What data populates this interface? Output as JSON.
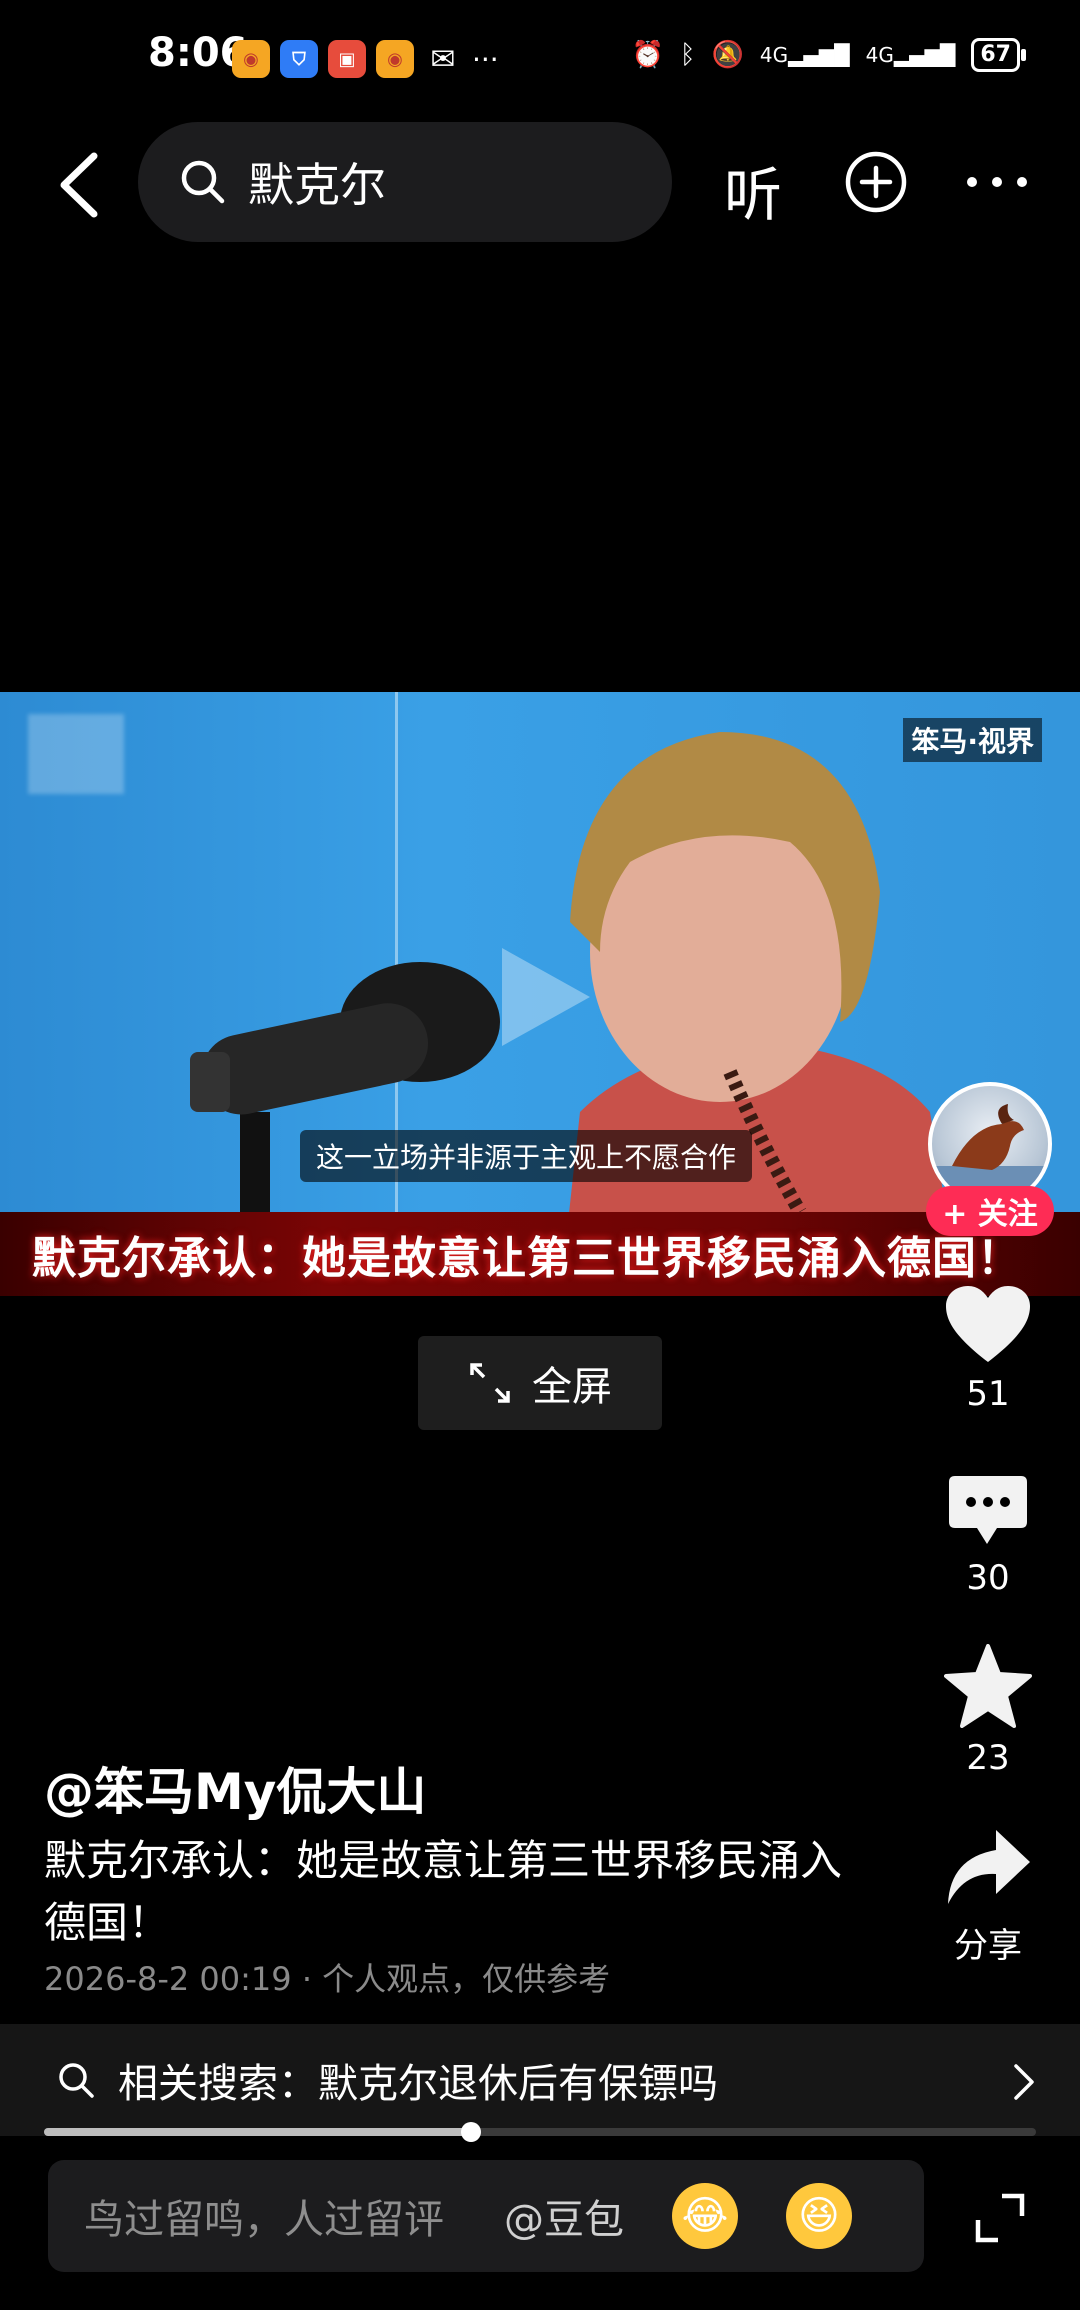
{
  "status_bar": {
    "time": "8:06",
    "apps": [
      {
        "icon": "weibo-icon",
        "color": "#f5a623"
      },
      {
        "icon": "shield-app-icon",
        "color": "#2f7cf6"
      },
      {
        "icon": "huawei-store-icon",
        "color": "#e74c3c"
      },
      {
        "icon": "weibo-icon",
        "color": "#f5a623"
      },
      {
        "icon": "wechat-icon",
        "color": "#ffffff"
      }
    ],
    "overflow": "···",
    "signal_left": "4G",
    "signal_right": "4G",
    "battery": "67"
  },
  "header": {
    "search_text": "默克尔",
    "listen_label": "听"
  },
  "video": {
    "watermark": "笨马·视界",
    "subtitle": "这一立场并非源于主观上不愿合作",
    "banner_title": "默克尔承认：她是故意让第三世界移民涌入德国！"
  },
  "follow_label": "+ 关注",
  "fullscreen_label": "全屏",
  "rail": {
    "likes": "51",
    "comments": "30",
    "favorites": "23",
    "share_label": "分享"
  },
  "post": {
    "author": "@笨马My侃大山",
    "description": "默克尔承认：她是故意让第三世界移民涌入德国！",
    "meta": "2026-8-2 00:19 · 个人观点，仅供参考"
  },
  "related": {
    "label": "相关搜索：默克尔退休后有保镖吗"
  },
  "progress": {
    "fraction": 0.43
  },
  "comment_bar": {
    "placeholder": "鸟过留鸣，人过留评",
    "at_label": "@豆包",
    "emoji_1": "😂",
    "emoji_2": "😆"
  }
}
